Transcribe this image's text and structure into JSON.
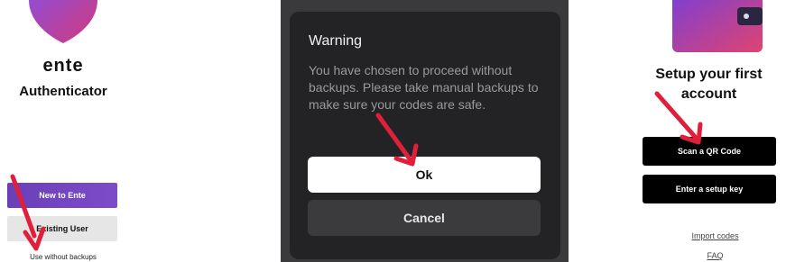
{
  "colors": {
    "arrow": "#e0203a",
    "primary_purple": "#7344c4",
    "dialog_bg": "#232325",
    "black_button": "#000000"
  },
  "left": {
    "logo_icon": "shield-heart-logo",
    "brand": "ente",
    "app_name": "Authenticator",
    "new_button": "New to Ente",
    "existing_button": "Existing User",
    "no_backup_link": "Use without backups"
  },
  "middle": {
    "dialog": {
      "title": "Warning",
      "message": "You have chosen to proceed without backups. Please take manual backups to make sure your codes are safe.",
      "ok_button": "Ok",
      "cancel_button": "Cancel"
    }
  },
  "right": {
    "illustration_icon": "wallet-illustration",
    "title": "Setup your first account",
    "scan_button": "Scan a QR Code",
    "setup_key_button": "Enter a setup key",
    "import_link": "Import codes",
    "faq_link": "FAQ"
  }
}
